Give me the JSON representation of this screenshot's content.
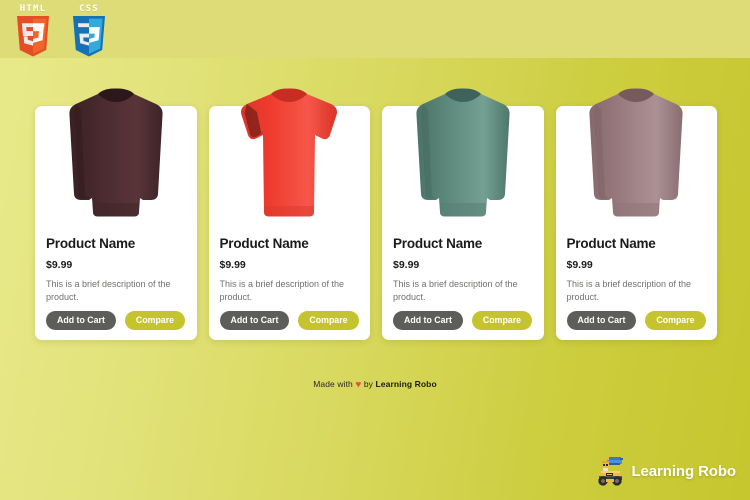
{
  "topbar": {
    "logos": [
      {
        "label": "HTML",
        "icon": "html5-shield-icon",
        "color": "#e44d26",
        "accent": "#f16529"
      },
      {
        "label": "CSS",
        "icon": "css3-shield-icon",
        "color": "#1572b6",
        "accent": "#33a9dc"
      }
    ]
  },
  "products": [
    {
      "name": "Product Name",
      "price": "$9.99",
      "description": "This is a brief description of the product.",
      "add_to_cart_label": "Add to Cart",
      "compare_label": "Compare",
      "image_name": "long-sleeve-shirt-maroon",
      "image_color": "#4a2b2f",
      "image_shade": "#3a2024",
      "image_highlight": "#593539",
      "sleeve": "long"
    },
    {
      "name": "Product Name",
      "price": "$9.99",
      "description": "This is a brief description of the product.",
      "add_to_cart_label": "Add to Cart",
      "compare_label": "Compare",
      "image_name": "t-shirt-red",
      "image_color": "#ef3b2e",
      "image_shade": "#d52b20",
      "image_highlight": "#f6574a",
      "sleeve": "short"
    },
    {
      "name": "Product Name",
      "price": "$9.99",
      "description": "This is a brief description of the product.",
      "add_to_cart_label": "Add to Cart",
      "compare_label": "Compare",
      "image_name": "long-sleeve-shirt-teal",
      "image_color": "#5e8a7d",
      "image_shade": "#4b7268",
      "image_highlight": "#74a093",
      "sleeve": "long"
    },
    {
      "name": "Product Name",
      "price": "$9.99",
      "description": "This is a brief description of the product.",
      "add_to_cart_label": "Add to Cart",
      "compare_label": "Compare",
      "image_name": "long-sleeve-shirt-mauve",
      "image_color": "#9a7c80",
      "image_shade": "#86696d",
      "image_highlight": "#ab9094",
      "sleeve": "long"
    }
  ],
  "footer": {
    "made_with": "Made with",
    "heart": "♥",
    "by": "by",
    "brand": "Learning Robo"
  },
  "watermark": {
    "icon": "learning-robo-robot-icon",
    "text": "Learning Robo"
  },
  "theme": {
    "background_start": "#e8e98a",
    "background_end": "#c6c62e",
    "topbar": "#dedc77",
    "card_bg": "#ffffff",
    "cart_button": "#5d5d5b",
    "compare_button": "#c5c42f",
    "heart_color": "#ef4c3f",
    "title_color": "#1b1b1b",
    "desc_color": "#70706e"
  }
}
